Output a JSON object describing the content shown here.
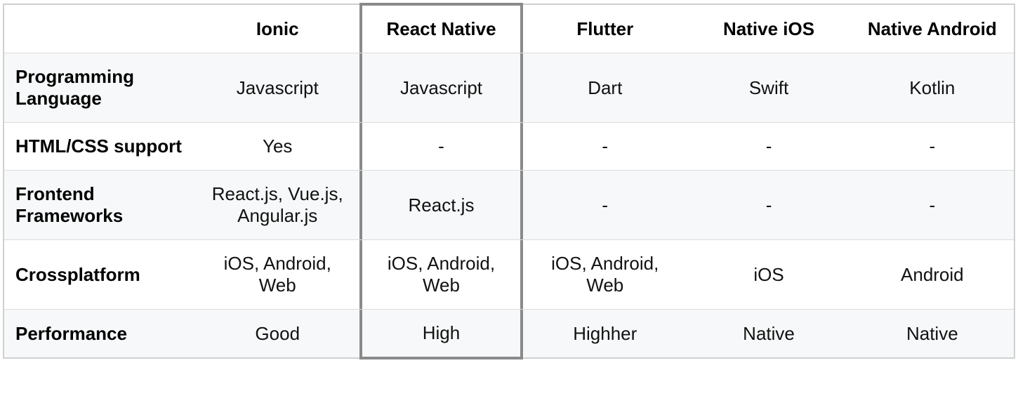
{
  "headers": [
    "",
    "Ionic",
    "React Native",
    "Flutter",
    "Native iOS",
    "Native Android"
  ],
  "highlight_column_index": 2,
  "rows": [
    {
      "label": "Programming Language",
      "cells": [
        "Javascript",
        "Javascript",
        "Dart",
        "Swift",
        "Kotlin"
      ]
    },
    {
      "label": "HTML/CSS support",
      "cells": [
        "Yes",
        "-",
        "-",
        "-",
        "-"
      ]
    },
    {
      "label": "Frontend Frameworks",
      "cells": [
        "React.js, Vue.js, Angular.js",
        "React.js",
        "-",
        "-",
        "-"
      ]
    },
    {
      "label": "Crossplatform",
      "cells": [
        "iOS, Android, Web",
        "iOS, Android, Web",
        "iOS, Android, Web",
        "iOS",
        "Android"
      ]
    },
    {
      "label": "Performance",
      "cells": [
        "Good",
        "High",
        "Highher",
        "Native",
        "Native"
      ]
    }
  ]
}
